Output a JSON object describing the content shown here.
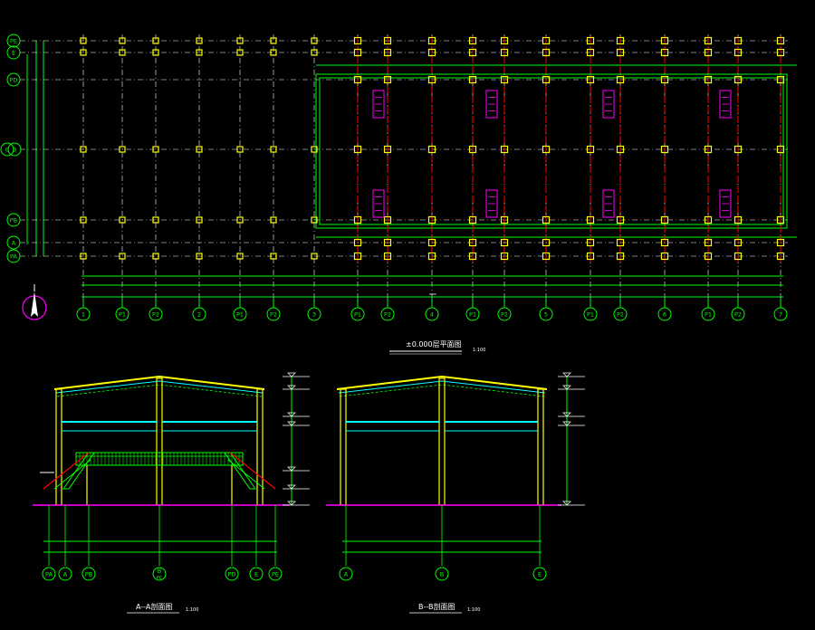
{
  "plan": {
    "title": "±0.000层平面图",
    "scale": "1:100",
    "row_axes": [
      "PE",
      "E",
      "PD",
      "C",
      "B",
      "PB",
      "A",
      "PA"
    ],
    "col_axes": [
      "1",
      "P1",
      "P2",
      "2",
      "P1",
      "P2",
      "3",
      "P1",
      "P2",
      "4",
      "P1",
      "P2",
      "5",
      "P1",
      "P2",
      "6",
      "P1",
      "P2",
      "7"
    ],
    "overall_dim": "6000"
  },
  "section_a": {
    "title": "A--A剖面图",
    "scale": "1:100",
    "axes": [
      "PA",
      "A",
      "PB",
      "B",
      "PD",
      "E",
      "PE"
    ],
    "axis_sub": "PC"
  },
  "section_b": {
    "title": "B--B剖面图",
    "scale": "1:100",
    "axes": [
      "A",
      "B",
      "E"
    ]
  },
  "colors": {
    "background": "#000000",
    "axis_line": "#00ff00",
    "grid_white": "#ffffff",
    "column_mark": "#ffff00",
    "red_line": "#ff0000",
    "magenta": "#ff00ff",
    "cyan": "#00ffff"
  }
}
